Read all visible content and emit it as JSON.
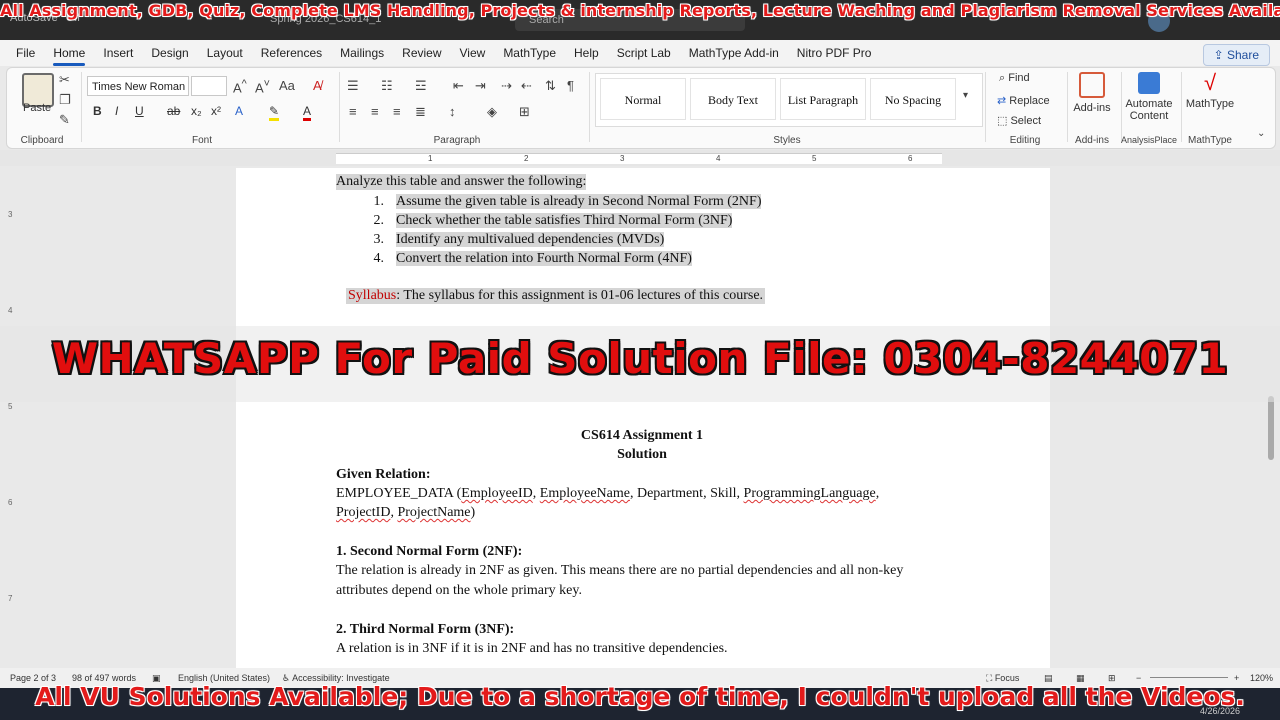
{
  "overlays": {
    "top_banner": "All Assignment, GDB, Quiz, Complete LMS Handling, Projects & internship Reports, Lecture Waching and Plagiarism Removal Services Available.",
    "middle_banner": "WHATSAPP For Paid Solution File: 0304-8244071",
    "bottom_banner": "All VU Solutions Available; Due to a shortage of time, I couldn't upload all the Videos."
  },
  "titlebar": {
    "autosave": "AutoSave",
    "autosave_state": "Off",
    "doc_title": "Spring 2026_CS614_1",
    "search_placeholder": "Search"
  },
  "menu": {
    "tabs": [
      "File",
      "Home",
      "Insert",
      "Design",
      "Layout",
      "References",
      "Mailings",
      "Review",
      "View",
      "MathType",
      "Help",
      "Script Lab",
      "MathType Add-in",
      "Nitro PDF Pro"
    ],
    "active": "Home",
    "share": "Share"
  },
  "ribbon": {
    "clipboard": {
      "paste": "Paste",
      "label": "Clipboard"
    },
    "font": {
      "name": "Times New Roman",
      "size": "",
      "label": "Font"
    },
    "paragraph": {
      "label": "Paragraph"
    },
    "styles": {
      "items": [
        "Normal",
        "Body Text",
        "List Paragraph",
        "No Spacing"
      ],
      "label": "Styles"
    },
    "editing": {
      "find": "Find",
      "replace": "Replace",
      "select": "Select",
      "label": "Editing"
    },
    "addins": {
      "button": "Add-ins",
      "label": "Add-ins"
    },
    "analysis": {
      "button_line1": "Automate",
      "button_line2": "Content",
      "label": "AnalysisPlace"
    },
    "mathtype": {
      "button": "MathType",
      "label": "MathType"
    }
  },
  "ruler": {
    "numbers": [
      "1",
      "2",
      "3",
      "4",
      "5",
      "6"
    ],
    "vnumbers": [
      "3",
      "4",
      "5",
      "6",
      "7"
    ]
  },
  "document": {
    "intro": "Analyze this table and answer the following:",
    "tasks": [
      "Assume the given table is already in Second Normal Form (2NF)",
      "Check whether the table satisfies Third Normal Form (3NF)",
      "Identify any multivalued dependencies (MVDs)",
      "Convert the relation into Fourth Normal Form (4NF)"
    ],
    "task_numbers": [
      "1.",
      "2.",
      "3.",
      "4."
    ],
    "syllabus_label": "Syllabus",
    "syllabus_text": ": The syllabus for this assignment is 01-06 lectures of this course.",
    "heading1": "CS614 Assignment 1",
    "heading2": "Solution",
    "given_relation_label": "Given Relation:",
    "relation_name": "EMPLOYEE_DATA (",
    "attr_employeeid": "EmployeeID",
    "attr_employeename": "EmployeeName",
    "attr_rest1": ", Department, Skill, ",
    "attr_proglang": "ProgrammingLanguage",
    "attr_projectid": "ProjectID",
    "attr_projectname": "ProjectName",
    "sec1_heading": "1. Second Normal Form (2NF):",
    "sec1_line1": "The relation is already in 2NF as given. This means there are no partial dependencies and all non-key",
    "sec1_line2": "attributes depend on the whole primary key.",
    "sec2_heading": "2. Third Normal Form (3NF):",
    "sec2_line1": "A relation is in 3NF if it is in 2NF and has no transitive dependencies."
  },
  "status": {
    "page": "Page 2 of 3",
    "words": "98 of 497 words",
    "language": "English (United States)",
    "accessibility": "Accessibility: Investigate",
    "focus": "Focus",
    "zoom": "120%",
    "date": "4/26/2026"
  }
}
